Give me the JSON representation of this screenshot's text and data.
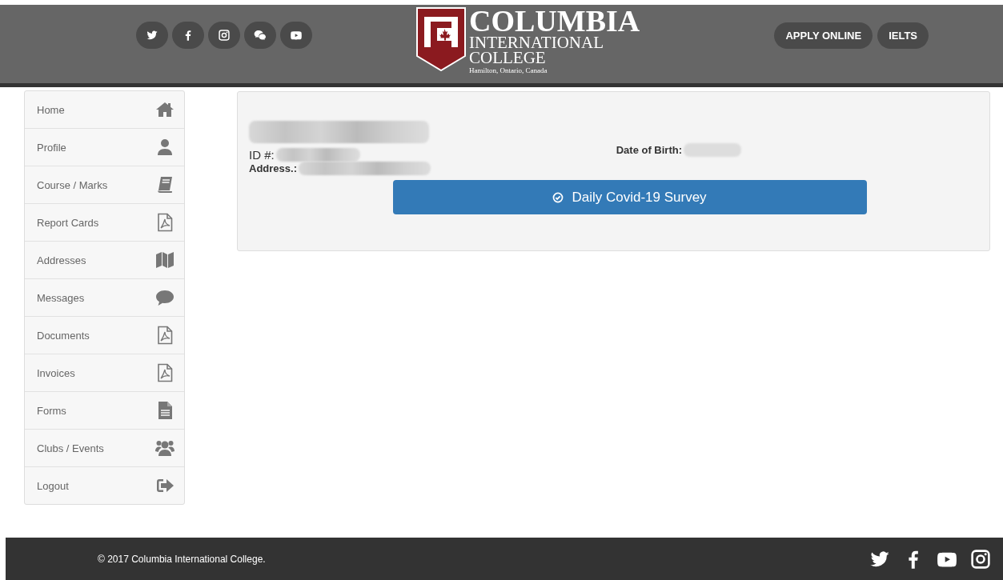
{
  "header": {
    "social": [
      {
        "kind": "twitter"
      },
      {
        "kind": "facebook"
      },
      {
        "kind": "instagram"
      },
      {
        "kind": "wechat"
      },
      {
        "kind": "youtube"
      }
    ],
    "logo": {
      "name": "COLUMBIA",
      "line2": "INTERNATIONAL",
      "line3": "COLLEGE",
      "place": "Hamilton, Ontario, Canada"
    },
    "buttons": [
      "APPLY ONLINE",
      "IELTS"
    ]
  },
  "sidebar": {
    "items": [
      {
        "label": "Home",
        "kind": "home"
      },
      {
        "label": "Profile",
        "kind": "user"
      },
      {
        "label": "Course / Marks",
        "kind": "book"
      },
      {
        "label": "Report Cards",
        "kind": "pdf"
      },
      {
        "label": "Addresses",
        "kind": "map"
      },
      {
        "label": "Messages",
        "kind": "chat"
      },
      {
        "label": "Documents",
        "kind": "pdf"
      },
      {
        "label": "Invoices",
        "kind": "pdf"
      },
      {
        "label": "Forms",
        "kind": "file"
      },
      {
        "label": "Clubs / Events",
        "kind": "users"
      },
      {
        "label": "Logout",
        "kind": "logout"
      }
    ]
  },
  "profile": {
    "id_label": "ID #:",
    "dob_label": "Date of Birth:",
    "address_label": "Address.:",
    "survey_button": "Daily Covid-19 Survey"
  },
  "footer": {
    "copyright": "© 2017 Columbia International College.",
    "social": [
      {
        "kind": "twitter"
      },
      {
        "kind": "facebook"
      },
      {
        "kind": "youtube"
      },
      {
        "kind": "instagram"
      }
    ]
  }
}
